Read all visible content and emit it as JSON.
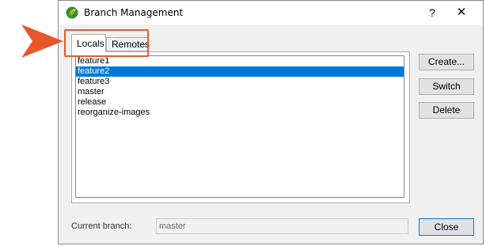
{
  "window": {
    "title": "Branch Management",
    "help_label": "?",
    "close_label": "✕"
  },
  "tabs": [
    {
      "label": "Locals",
      "active": true
    },
    {
      "label": "Remotes",
      "active": false
    }
  ],
  "branches": [
    "feature1",
    "feature2",
    "feature3",
    "master",
    "release",
    "reorganize-images"
  ],
  "selected_branch": "feature2",
  "actions": {
    "create": "Create...",
    "switch": "Switch",
    "delete": "Delete",
    "close": "Close"
  },
  "current_branch": {
    "label": "Current branch:",
    "value": "master"
  },
  "colors": {
    "selection": "#0078d7",
    "callout": "#e25a32",
    "app_icon": "#3aa03a"
  },
  "icons": {
    "app": "leaf-app-icon",
    "callout_arrow": "callout-arrow-icon"
  }
}
